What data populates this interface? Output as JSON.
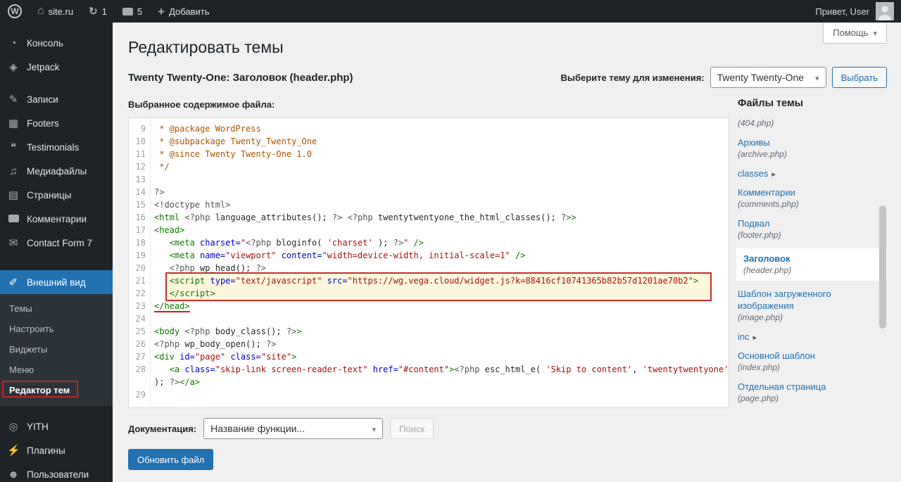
{
  "colors": {
    "accent": "#2271b1",
    "annotation_red": "#c52222",
    "code_highlight_bg": "#fcf7dd"
  },
  "admin_bar": {
    "site_name": "site.ru",
    "updates_count": "1",
    "comments_count": "5",
    "new_label": "Добавить",
    "greeting": "Привет, User"
  },
  "sidebar": {
    "items": [
      {
        "label": "Консоль",
        "icon": "dashboard-icon"
      },
      {
        "label": "Jetpack",
        "icon": "jetpack-icon"
      },
      {
        "label": "Записи",
        "icon": "posts-icon"
      },
      {
        "label": "Footers",
        "icon": "footers-icon"
      },
      {
        "label": "Testimonials",
        "icon": "testimonials-icon"
      },
      {
        "label": "Медиафайлы",
        "icon": "media-icon"
      },
      {
        "label": "Страницы",
        "icon": "pages-icon"
      },
      {
        "label": "Комментарии",
        "icon": "comments-icon"
      },
      {
        "label": "Contact Form 7",
        "icon": "mail-icon"
      },
      {
        "label": "Внешний вид",
        "icon": "appearance-icon",
        "active": true
      },
      {
        "label": "YITH",
        "icon": "yith-icon"
      },
      {
        "label": "Плагины",
        "icon": "plugins-icon"
      },
      {
        "label": "Пользователи",
        "icon": "users-icon"
      }
    ],
    "appearance_submenu": [
      {
        "label": "Темы"
      },
      {
        "label": "Настроить"
      },
      {
        "label": "Виджеты"
      },
      {
        "label": "Меню"
      },
      {
        "label": "Редактор тем",
        "current": true
      }
    ]
  },
  "page": {
    "title": "Редактировать темы",
    "help_label": "Помощь",
    "file_subtitle": "Twenty Twenty-One: Заголовок (header.php)",
    "content_label": "Выбранное содержимое файла:"
  },
  "theme_switcher": {
    "label": "Выберите тему для изменения:",
    "selected_theme": "Twenty Twenty-One",
    "button": "Выбрать"
  },
  "files_panel": {
    "title": "Файлы темы",
    "items": [
      {
        "file": "(404.php)"
      },
      {
        "label": "Архивы",
        "file": "(archive.php)"
      },
      {
        "label": "classes",
        "folder": true
      },
      {
        "label": "Комментарии",
        "file": "(comments.php)"
      },
      {
        "label": "Подвал",
        "file": "(footer.php)"
      },
      {
        "label": "Заголовок",
        "file": "(header.php)",
        "active": true
      },
      {
        "label": "Шаблон загруженного изображения",
        "file": "(image.php)"
      },
      {
        "label": "inc",
        "folder": true
      },
      {
        "label": "Основной шаблон",
        "file": "(index.php)"
      },
      {
        "label": "Отдельная страница",
        "file": "(page.php)"
      }
    ]
  },
  "docs": {
    "label": "Документация:",
    "select_value": "Название функции...",
    "search_button": "Поиск"
  },
  "update_button": "Обновить файл",
  "editor": {
    "rows": [
      {
        "num": "9",
        "segments": [
          [
            "c",
            " * @package WordPress"
          ]
        ]
      },
      {
        "num": "10",
        "segments": [
          [
            "c",
            " * @subpackage Twenty_Twenty_One"
          ]
        ]
      },
      {
        "num": "11",
        "segments": [
          [
            "c",
            " * @since Twenty Twenty-One 1.0"
          ]
        ]
      },
      {
        "num": "12",
        "segments": [
          [
            "c",
            " */"
          ]
        ]
      },
      {
        "num": "13",
        "segments": []
      },
      {
        "num": "14",
        "segments": [
          [
            "m",
            "?>"
          ]
        ]
      },
      {
        "num": "15",
        "segments": [
          [
            "m",
            "<!doctype html>"
          ]
        ]
      },
      {
        "num": "16",
        "segments": [
          [
            "t",
            "<html"
          ],
          [
            "d",
            " "
          ],
          [
            "m",
            "<?php"
          ],
          [
            "d",
            " language_attributes(); "
          ],
          [
            "m",
            "?>"
          ],
          [
            "d",
            " "
          ],
          [
            "m",
            "<?php"
          ],
          [
            "d",
            " twentytwentyone_the_html_classes(); "
          ],
          [
            "m",
            "?>"
          ],
          [
            "t",
            ">"
          ]
        ]
      },
      {
        "num": "17",
        "segments": [
          [
            "t",
            "<head>"
          ]
        ]
      },
      {
        "num": "18",
        "segments": [
          [
            "d",
            "\t"
          ],
          [
            "t",
            "<meta"
          ],
          [
            "a",
            " charset="
          ],
          [
            "s",
            "\""
          ],
          [
            "m",
            "<?php"
          ],
          [
            "d",
            " bloginfo( "
          ],
          [
            "s",
            "'charset'"
          ],
          [
            "d",
            " ); "
          ],
          [
            "m",
            "?>"
          ],
          [
            "s",
            "\""
          ],
          [
            "t",
            " />"
          ]
        ]
      },
      {
        "num": "19",
        "segments": [
          [
            "d",
            "\t"
          ],
          [
            "t",
            "<meta"
          ],
          [
            "a",
            " name="
          ],
          [
            "s",
            "\"viewport\""
          ],
          [
            "a",
            " content="
          ],
          [
            "s",
            "\"width=device-width, initial-scale=1\""
          ],
          [
            "t",
            " />"
          ]
        ]
      },
      {
        "num": "20",
        "segments": [
          [
            "d",
            "\t"
          ],
          [
            "m",
            "<?php"
          ],
          [
            "d",
            " wp_head(); "
          ],
          [
            "m",
            "?>"
          ]
        ]
      },
      {
        "num": "21",
        "flag": true,
        "segments": [
          [
            "d",
            "\t"
          ],
          [
            "t",
            "<script"
          ],
          [
            "a",
            " type="
          ],
          [
            "s",
            "\"text/javascript\""
          ],
          [
            "a",
            " src="
          ],
          [
            "s",
            "\"https://wg.vega.cloud/widget.js?k=88416cf10741365b82b57d1201ae70b2\""
          ],
          [
            "t",
            ">"
          ]
        ]
      },
      {
        "num": "22",
        "flag": true,
        "segments": [
          [
            "d",
            "\t"
          ],
          [
            "t",
            "</script>"
          ]
        ]
      },
      {
        "num": "23",
        "segments": [
          [
            "t u",
            "</head>"
          ]
        ]
      },
      {
        "num": "24",
        "segments": []
      },
      {
        "num": "25",
        "segments": [
          [
            "t",
            "<body"
          ],
          [
            "d",
            " "
          ],
          [
            "m",
            "<?php"
          ],
          [
            "d",
            " body_class(); "
          ],
          [
            "m",
            "?>"
          ],
          [
            "t",
            ">"
          ]
        ]
      },
      {
        "num": "26",
        "segments": [
          [
            "m",
            "<?php"
          ],
          [
            "d",
            " wp_body_open(); "
          ],
          [
            "m",
            "?>"
          ]
        ]
      },
      {
        "num": "27",
        "segments": [
          [
            "t",
            "<div"
          ],
          [
            "a",
            " id="
          ],
          [
            "s",
            "\"page\""
          ],
          [
            "a",
            " class="
          ],
          [
            "s",
            "\"site\""
          ],
          [
            "t",
            ">"
          ]
        ]
      },
      {
        "num": "28",
        "segments": [
          [
            "d",
            "\t"
          ],
          [
            "t",
            "<a"
          ],
          [
            "a",
            " class="
          ],
          [
            "s",
            "\"skip-link screen-reader-text\""
          ],
          [
            "a",
            " href="
          ],
          [
            "s",
            "\"#content\""
          ],
          [
            "t",
            ">"
          ],
          [
            "m",
            "<?php"
          ],
          [
            "d",
            " esc_html_e( "
          ],
          [
            "s",
            "'Skip to content'"
          ],
          [
            "d",
            ", "
          ],
          [
            "s",
            "'twentytwentyone'"
          ],
          [
            "d",
            " "
          ]
        ]
      },
      {
        "num": "",
        "segments": [
          [
            "d",
            "); "
          ],
          [
            "m",
            "?>"
          ],
          [
            "t",
            "</a>"
          ]
        ]
      },
      {
        "num": "29",
        "segments": []
      }
    ]
  }
}
